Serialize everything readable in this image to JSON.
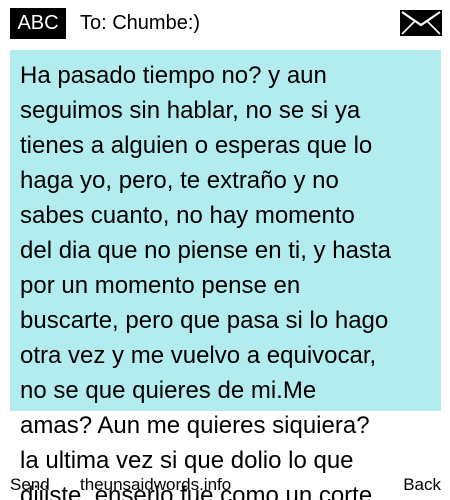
{
  "header": {
    "input_mode": "ABC",
    "recipient": "To: Chumbe:)",
    "icon": "envelope-icon"
  },
  "message": {
    "text": "Ha pasado tiempo no? y aun\nseguimos sin hablar, no se si ya\ntienes a alguien o esperas que lo\nhaga yo, pero, te extraño y no\nsabes cuanto, no hay momento\ndel dia que no piense en ti, y hasta\npor un momento pense en\nbuscarte, pero que pasa si lo hago\notra vez y me vuelvo a equivocar,\nno se que quieres de mi.Me\namas? Aun me quieres siquiera?\nla ultima vez si que dolio lo que\ndijiste, enserio fue como un corte"
  },
  "softkeys": {
    "left": "Send",
    "center": "theunsaidwords.info",
    "right": "Back"
  },
  "colors": {
    "highlight": "#b2ecee",
    "badge": "#000000"
  }
}
